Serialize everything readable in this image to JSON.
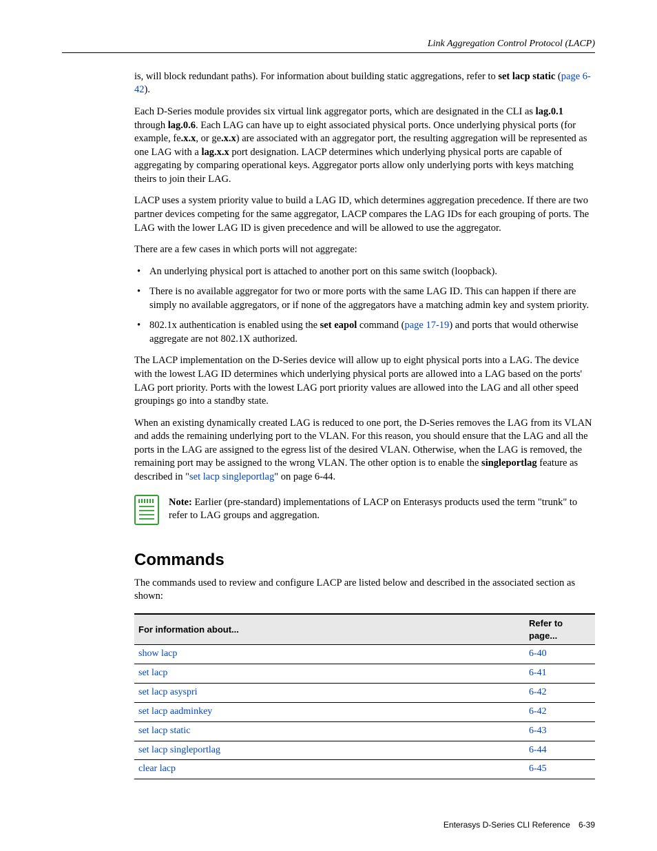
{
  "header": {
    "section_title": "Link Aggregation Control Protocol (LACP)"
  },
  "body": {
    "p1a": "is, will block redundant paths). For information about building static aggregations, refer to ",
    "p1b_bold": "set lacp static",
    "p1c": " (",
    "p1_link": "page 6-42",
    "p1d": ").",
    "p2a": "Each D-Series module provides six virtual link aggregator ports, which are designated in the CLI as ",
    "p2b": "lag.0.1",
    "p2c": " through ",
    "p2d": "lag.0.6",
    "p2e": ". Each LAG can have up to eight associated physical ports. Once underlying physical ports (for example, fe",
    "p2f": ".x.x",
    "p2g": ", or ge",
    "p2h": ".x.x",
    "p2i": ") are associated with an aggregator port, the resulting aggregation will be represented as one LAG with a ",
    "p2j": "lag.x.x",
    "p2k": " port designation. LACP determines which underlying physical ports are capable of aggregating by comparing operational keys. Aggregator ports allow only underlying ports with keys matching theirs to join their LAG.",
    "p3": "LACP uses a system priority value to build a LAG ID, which determines aggregation precedence. If there are two partner devices competing for the same aggregator, LACP compares the LAG IDs for each grouping of ports. The LAG with the lower LAG ID is given precedence and will be allowed to use the aggregator.",
    "p4": "There are a few cases in which ports will not aggregate:",
    "b1": "An underlying physical port is attached to another port on this same switch (loopback).",
    "b2": "There is no available aggregator for two or more ports with the same LAG ID. This can happen if there are simply no available aggregators, or if none of the aggregators have a matching admin key and system priority.",
    "b3a": "802.1x authentication is enabled using the ",
    "b3b_bold": "set eapol",
    "b3c": " command (",
    "b3_link": "page 17-19",
    "b3d": ") and ports that would otherwise aggregate are not 802.1X authorized.",
    "p5": "The LACP implementation on the D-Series device will allow up to eight physical ports into a LAG. The device with the lowest LAG ID determines which underlying physical ports are allowed into a LAG based on the ports' LAG port priority. Ports with the lowest LAG port priority values are allowed into the LAG and all other speed groupings go into a standby state.",
    "p6a": "When an existing dynamically created LAG is reduced to one port, the D-Series removes the LAG from its VLAN and adds the remaining underlying port to the VLAN. For this reason, you should ensure that the LAG and all the ports in the LAG are assigned to the egress list of the desired VLAN. Otherwise, when the LAG is removed, the remaining port may be assigned to the wrong VLAN. The other option is to enable the ",
    "p6b_bold": "singleportlag",
    "p6c": " feature as described in \"",
    "p6_link": "set lacp singleportlag",
    "p6d": "\" on page 6-44.",
    "note_label": "Note:",
    "note_text": " Earlier (pre-standard) implementations of LACP on Enterasys products used the term \"trunk\" to refer to LAG groups and aggregation."
  },
  "commands": {
    "title": "Commands",
    "intro": "The commands used to review and configure LACP are listed below and described in the associated section as shown:",
    "th1": "For information about...",
    "th2": "Refer to page...",
    "rows": [
      {
        "cmd": "show lacp",
        "page": "6-40"
      },
      {
        "cmd": "set lacp",
        "page": "6-41"
      },
      {
        "cmd": "set lacp asyspri",
        "page": "6-42"
      },
      {
        "cmd": "set lacp aadminkey",
        "page": "6-42"
      },
      {
        "cmd": "set lacp static",
        "page": "6-43"
      },
      {
        "cmd": "set lacp singleportlag",
        "page": "6-44"
      },
      {
        "cmd": "clear lacp",
        "page": "6-45"
      }
    ]
  },
  "footer": {
    "book": "Enterasys D-Series CLI Reference",
    "page": "6-39"
  }
}
